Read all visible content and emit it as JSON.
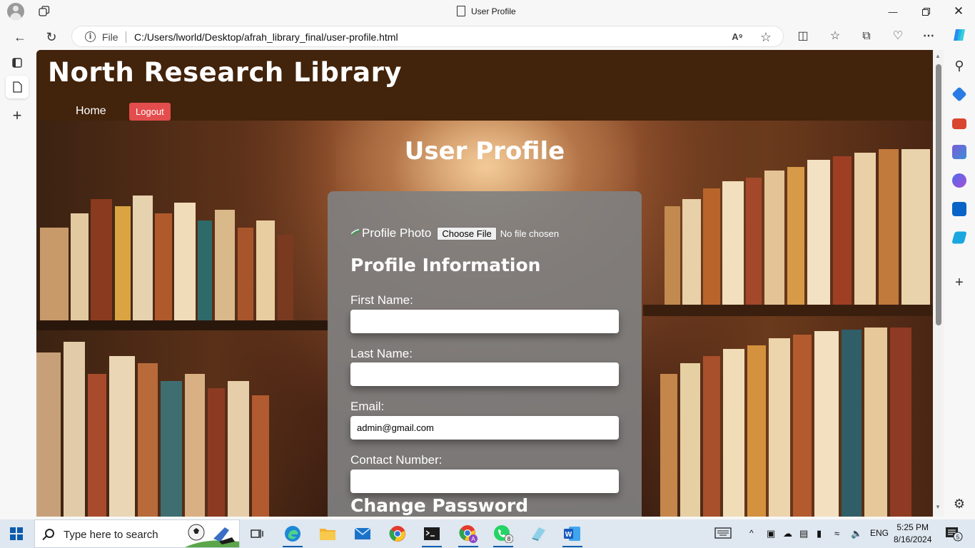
{
  "browser": {
    "tab_title": "User Profile",
    "address": {
      "scheme_label": "File",
      "url": "C:/Users/lworld/Desktop/afrah_library_final/user-profile.html"
    }
  },
  "site": {
    "title": "North Research Library",
    "nav": {
      "home": "Home",
      "logout": "Logout"
    },
    "colors": {
      "header_bg": "#42230b",
      "logout_bg": "#e44d4d",
      "card_bg": "#808080"
    }
  },
  "page": {
    "heading": "User Profile",
    "photo": {
      "alt_text": "Profile Photo",
      "choose_button": "Choose File",
      "no_file": "No file chosen"
    },
    "profile_section_title": "Profile Information",
    "fields": [
      {
        "label": "First Name:",
        "value": ""
      },
      {
        "label": "Last Name:",
        "value": ""
      },
      {
        "label": "Email:",
        "value": "admin@gmail.com"
      },
      {
        "label": "Contact Number:",
        "value": ""
      }
    ],
    "password_section_title": "Change Password"
  },
  "taskbar": {
    "search_placeholder": "Type here to search",
    "language": "ENG",
    "time": "5:25 PM",
    "date": "8/16/2024",
    "whatsapp_badge": "8",
    "notification_badge": "5"
  }
}
